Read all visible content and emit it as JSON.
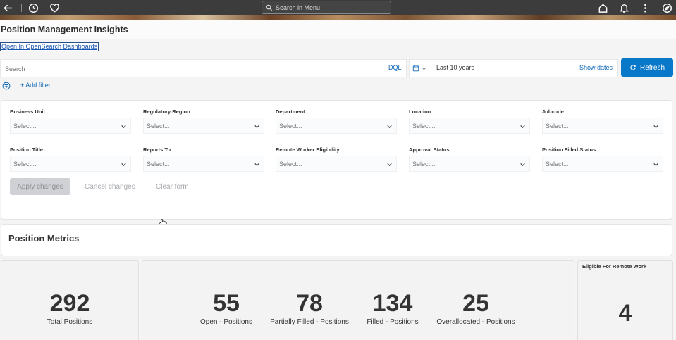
{
  "topbar": {
    "search_placeholder": "Search in Menu",
    "icons": [
      "back-arrow-icon",
      "clock-icon",
      "heart-icon",
      "home-icon",
      "bell-icon",
      "more-vertical-icon",
      "compass-icon"
    ]
  },
  "page": {
    "title": "Position Management Insights",
    "dashboard_link": "Open In OpenSearch Dashboards"
  },
  "query": {
    "search_placeholder": "Search",
    "language": "DQL",
    "date_range": "Last 10 years",
    "show_dates": "Show dates",
    "refresh": "Refresh",
    "add_filter": "+ Add filter"
  },
  "controls": {
    "fields": [
      {
        "label": "Business Unit",
        "placeholder": "Select..."
      },
      {
        "label": "Regulatory Region",
        "placeholder": "Select..."
      },
      {
        "label": "Department",
        "placeholder": "Select..."
      },
      {
        "label": "Location",
        "placeholder": "Select..."
      },
      {
        "label": "Jobcode",
        "placeholder": "Select..."
      },
      {
        "label": "Position Title",
        "placeholder": "Select..."
      },
      {
        "label": "Reports To",
        "placeholder": "Select..."
      },
      {
        "label": "Remote Worker Eligibility",
        "placeholder": "Select..."
      },
      {
        "label": "Approval Status",
        "placeholder": "Select..."
      },
      {
        "label": "Position Filled Status",
        "placeholder": "Select..."
      }
    ],
    "apply": "Apply changes",
    "cancel": "Cancel changes",
    "clear": "Clear form"
  },
  "metrics": {
    "section_title": "Position Metrics",
    "total": {
      "value": "292",
      "label": "Total Positions"
    },
    "breakdown": [
      {
        "value": "55",
        "label": "Open - Positions"
      },
      {
        "value": "78",
        "label": "Partially Filled - Positions"
      },
      {
        "value": "134",
        "label": "Filled - Positions"
      },
      {
        "value": "25",
        "label": "Overallocated - Positions"
      }
    ],
    "remote": {
      "heading": "Eligible For Remote Work",
      "value": "4"
    }
  }
}
